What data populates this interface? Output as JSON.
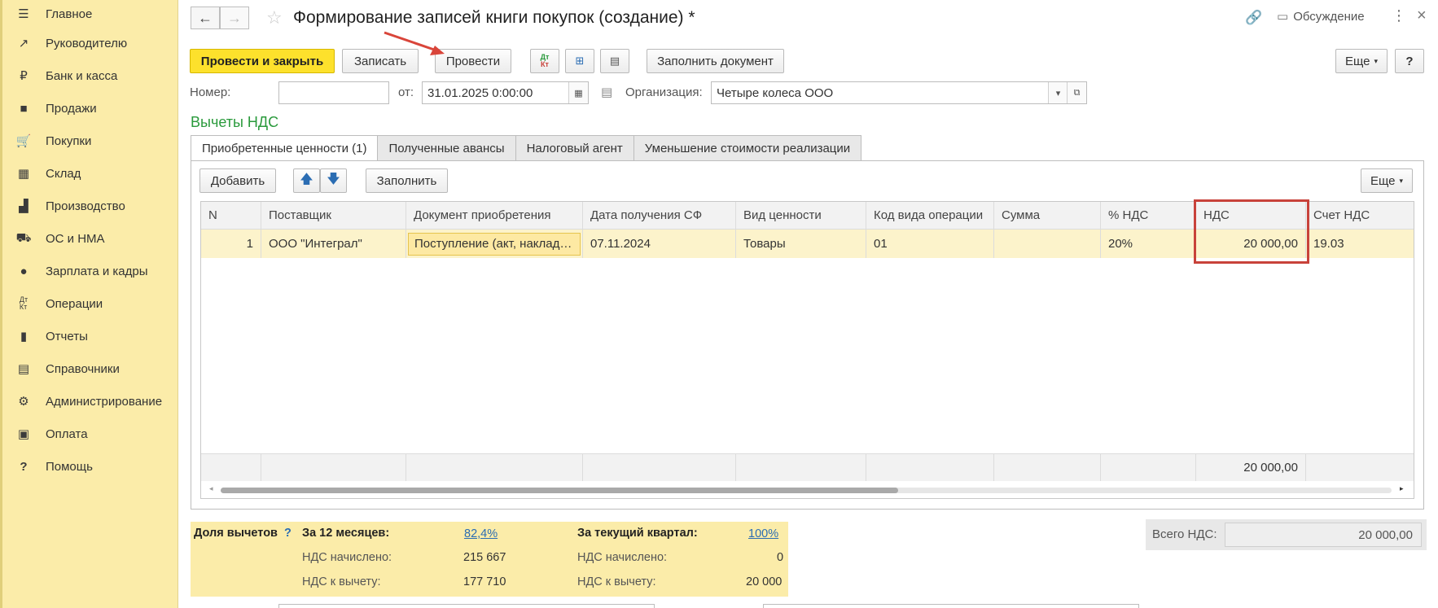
{
  "sidebar": {
    "items": [
      {
        "label": "Главное",
        "icon": "menu-icon"
      },
      {
        "label": "Руководителю",
        "icon": "trend-icon"
      },
      {
        "label": "Банк и касса",
        "icon": "ruble-icon"
      },
      {
        "label": "Продажи",
        "icon": "bag-icon"
      },
      {
        "label": "Покупки",
        "icon": "cart-icon"
      },
      {
        "label": "Склад",
        "icon": "warehouse-icon"
      },
      {
        "label": "Производство",
        "icon": "factory-icon"
      },
      {
        "label": "ОС и НМА",
        "icon": "truck-icon"
      },
      {
        "label": "Зарплата и кадры",
        "icon": "person-icon"
      },
      {
        "label": "Операции",
        "icon": "dt-kt-icon"
      },
      {
        "label": "Отчеты",
        "icon": "bar-chart-icon"
      },
      {
        "label": "Справочники",
        "icon": "books-icon"
      },
      {
        "label": "Администрирование",
        "icon": "gear-icon"
      },
      {
        "label": "Оплата",
        "icon": "wallet-icon"
      },
      {
        "label": "Помощь",
        "icon": "question-icon"
      }
    ]
  },
  "header": {
    "title": "Формирование записей книги покупок (создание) *",
    "discussion_label": "Обсуждение"
  },
  "toolbar": {
    "post_close": "Провести и закрыть",
    "save": "Записать",
    "post": "Провести",
    "dt_kt": "Дт Кт",
    "fill_doc": "Заполнить документ",
    "more": "Еще",
    "help": "?"
  },
  "form": {
    "number_label": "Номер:",
    "number_value": "",
    "date_label": "от:",
    "date_value": "31.01.2025  0:00:00",
    "org_label": "Организация:",
    "org_value": "Четыре колеса ООО"
  },
  "section_title": "Вычеты НДС",
  "tabs": [
    {
      "label": "Приобретенные ценности (1)",
      "active": true
    },
    {
      "label": "Полученные авансы",
      "active": false
    },
    {
      "label": "Налоговый агент",
      "active": false
    },
    {
      "label": "Уменьшение стоимости реализации",
      "active": false
    }
  ],
  "table_toolbar": {
    "add": "Добавить",
    "fill": "Заполнить",
    "more": "Еще"
  },
  "table": {
    "columns": [
      "N",
      "Поставщик",
      "Документ приобретения",
      "Дата получения СФ",
      "Вид ценности",
      "Код вида операции",
      "Сумма",
      "% НДС",
      "НДС",
      "Счет НДС"
    ],
    "rows": [
      [
        "1",
        "ООО \"Интеграл\"",
        "Поступление (акт, наклад…",
        "07.11.2024",
        "Товары",
        "01",
        "",
        "20%",
        "20 000,00",
        "19.03"
      ]
    ],
    "footer_vat_total": "20 000,00"
  },
  "deductions": {
    "share_label": "Доля вычетов",
    "q_mark": "?",
    "months12_label": "За 12 месяцев:",
    "months12_pct": "82,4%",
    "accrued_label": "НДС начислено:",
    "months12_accrued": "215 667",
    "deductible_label": "НДС к вычету:",
    "months12_deductible": "177 710",
    "quarter_label": "За текущий квартал:",
    "quarter_pct": "100%",
    "quarter_accrued": "0",
    "quarter_deductible": "20 000"
  },
  "total": {
    "label": "Всего НДС:",
    "value": "20 000,00"
  },
  "colors": {
    "sidebar_bg": "#fbeca9",
    "primary_button": "#fde12c",
    "section_title": "#2a9a3c",
    "highlight": "#c8423a",
    "selected_row": "#fcf3cb"
  }
}
